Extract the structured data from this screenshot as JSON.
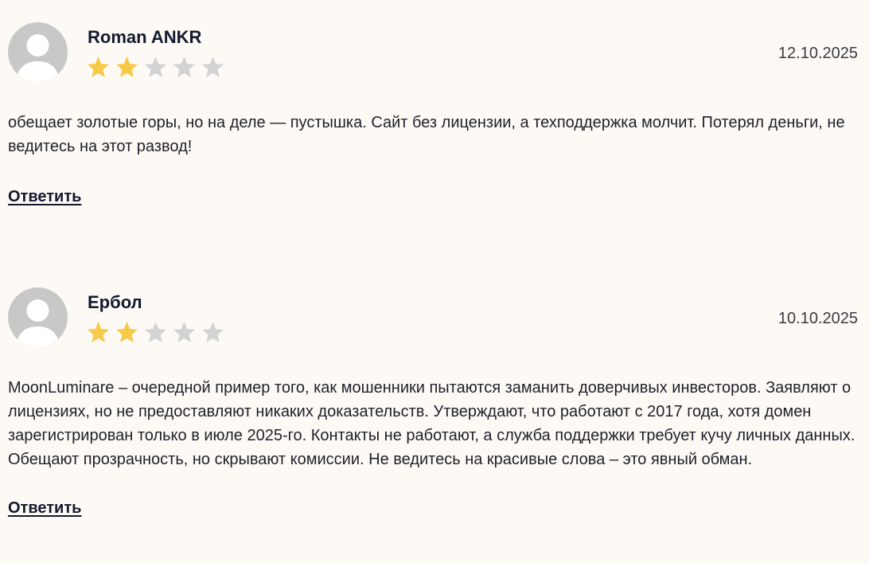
{
  "reviews": [
    {
      "author": "Roman ANKR",
      "date": "12.10.2025",
      "rating": 2,
      "max_rating": 5,
      "text": "обещает золотые горы, но на деле — пустышка. Сайт без лицензии, а техподдержка молчит. Потерял деньги, не ведитесь на этот развод!",
      "reply_label": "Ответить"
    },
    {
      "author": "Ербол",
      "date": "10.10.2025",
      "rating": 2,
      "max_rating": 5,
      "text": "MoonLuminare – очередной пример того, как мошенники пытаются заманить доверчивых инвесторов. Заявляют о лицензиях, но не предоставляют никаких доказательств. Утверждают, что работают с 2017 года, хотя домен зарегистрирован только в июле 2025-го. Контакты не работают, а служба поддержки требует кучу личных данных. Обещают прозрачность, но скрывают комиссии. Не ведитесь на красивые слова – это явный обман.",
      "reply_label": "Ответить"
    }
  ],
  "colors": {
    "background": "#fdfaf6",
    "star_filled": "#f7c948",
    "star_empty": "#d3d3d6",
    "avatar_bg": "#c8c8c8",
    "avatar_fg": "#ffffff"
  },
  "icons": {
    "avatar": "user-placeholder-icon",
    "star": "star-icon"
  }
}
